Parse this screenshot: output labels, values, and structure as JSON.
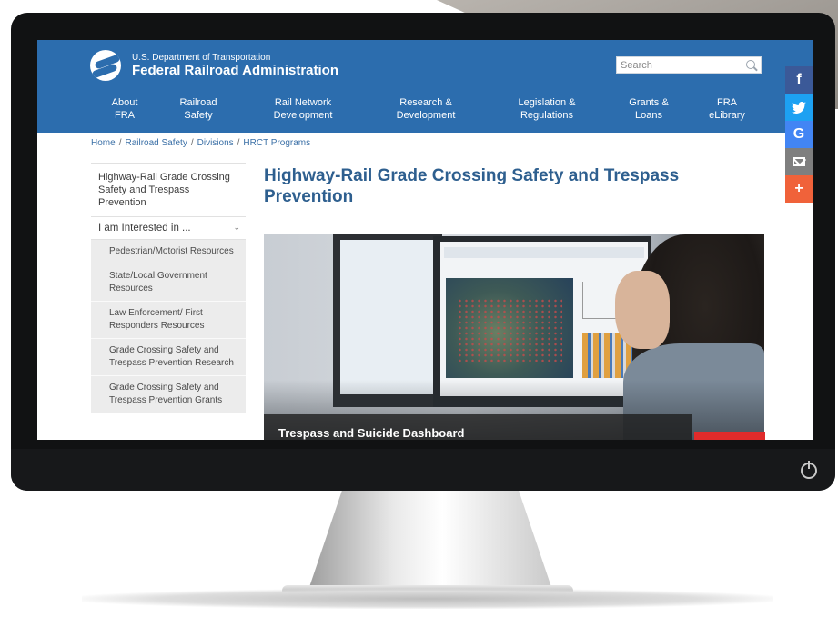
{
  "header": {
    "agency_small": "U.S. Department of Transportation",
    "agency_name": "Federal Railroad Administration",
    "search_placeholder": "Search"
  },
  "nav": [
    {
      "line1": "About",
      "line2": "FRA"
    },
    {
      "line1": "Railroad",
      "line2": "Safety"
    },
    {
      "line1": "Rail Network",
      "line2": "Development"
    },
    {
      "line1": "Research &",
      "line2": "Development"
    },
    {
      "line1": "Legislation &",
      "line2": "Regulations"
    },
    {
      "line1": "Grants &",
      "line2": "Loans"
    },
    {
      "line1": "FRA",
      "line2": "eLibrary"
    }
  ],
  "breadcrumb": [
    "Home",
    "Railroad Safety",
    "Divisions",
    "HRCT Programs"
  ],
  "sidebar": {
    "main": "Highway-Rail Grade Crossing Safety and Trespass Prevention",
    "interest": "I am Interested in ...",
    "items": [
      "Pedestrian/Motorist Resources",
      "State/Local Government Resources",
      "Law Enforcement/ First Responders Resources",
      "Grade Crossing Safety and Trespass Prevention Research",
      "Grade Crossing Safety and Trespass Prevention Grants"
    ]
  },
  "main": {
    "title": "Highway-Rail Grade Crossing Safety and Trespass Prevention",
    "caption": "Trespass and Suicide Dashboard"
  },
  "social": [
    "f",
    "G",
    "+"
  ],
  "colors": {
    "header": "#2c6dae",
    "title": "#2e5f8f",
    "accent_red": "#e02b2b"
  }
}
